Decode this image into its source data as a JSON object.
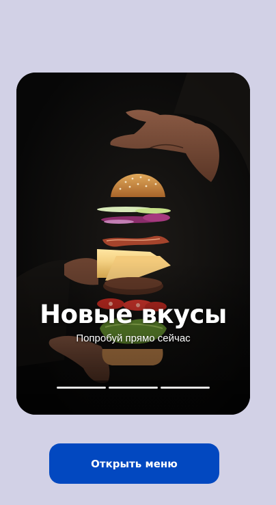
{
  "promo": {
    "title": "Новые вкусы",
    "subtitle": "Попробуй прямо сейчас",
    "image_subject": "burger-ingredients-floating-between-hands",
    "pages": 3
  },
  "actions": {
    "open_menu_label": "Открыть меню"
  },
  "colors": {
    "background": "#d2d1e6",
    "card": "#0b0b0b",
    "button": "#0248c0",
    "button_text": "#ffffff",
    "pager": "#e6e6e6"
  }
}
